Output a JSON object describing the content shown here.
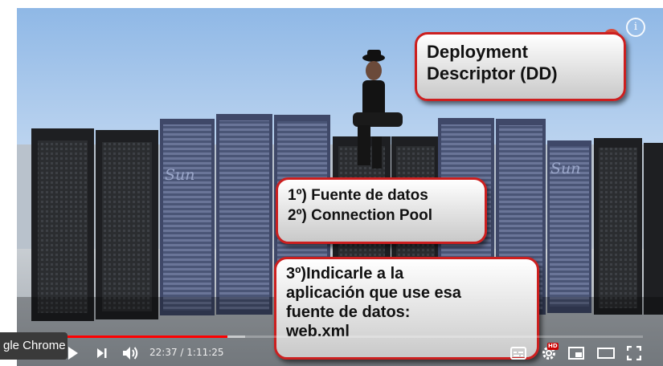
{
  "app": {
    "taskbar_label": "gle Chrome"
  },
  "video": {
    "watermark": "i",
    "progress_fraction": 0.3,
    "buffered_fraction": 0.33,
    "current_time": "22:37",
    "separator": " / ",
    "duration": "1:11:25",
    "hd_badge": "HD"
  },
  "callouts": {
    "deployment": [
      "Deployment",
      "Descriptor (DD)"
    ],
    "steps": [
      "1º) Fuente de datos",
      "2º) Connection Pool"
    ],
    "step3": [
      "3º)Indicarle a la",
      "aplicación que use esa",
      "fuente de datos:",
      "web.xml"
    ]
  },
  "scene_text": {
    "rack_logo": "Sun"
  },
  "icons": {
    "play": "play-icon",
    "next": "next-icon",
    "volume": "volume-icon",
    "captions": "captions-icon",
    "settings": "settings-icon",
    "miniplayer": "miniplayer-icon",
    "theater": "theater-icon",
    "fullscreen": "fullscreen-icon",
    "info": "info-icon"
  },
  "colors": {
    "progress": "#ff0000",
    "callout_border": "#cc1f1f"
  }
}
